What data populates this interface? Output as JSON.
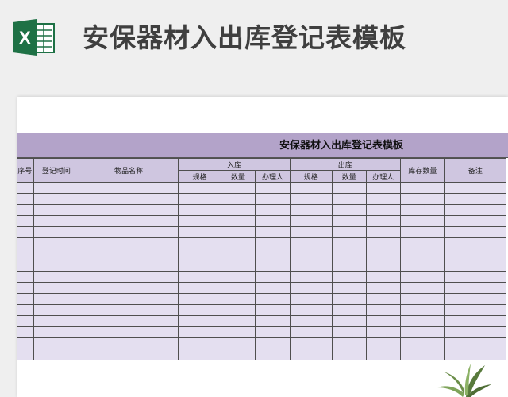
{
  "banner": {
    "icon": "excel-icon",
    "icon_letter": "X",
    "title": "安保器材入出库登记表模板"
  },
  "sheet": {
    "title": "安保器材入出库登记表模板",
    "headers": {
      "seq": "序号",
      "date": "登记时间",
      "item": "物品名称",
      "in_group": "入库",
      "out_group": "出库",
      "stock": "库存数量",
      "remark": "备注",
      "in_sub": [
        "规格",
        "数量",
        "办理人"
      ],
      "out_sub": [
        "规格",
        "数量",
        "办理人"
      ]
    },
    "empty_rows": 16
  },
  "colors": {
    "title_bar": "#b3a3c9",
    "header_cell": "#cfc6e0",
    "body_cell": "#e4dff0",
    "excel_green": "#1e7145"
  },
  "decor": {
    "plant": "plant-icon"
  }
}
